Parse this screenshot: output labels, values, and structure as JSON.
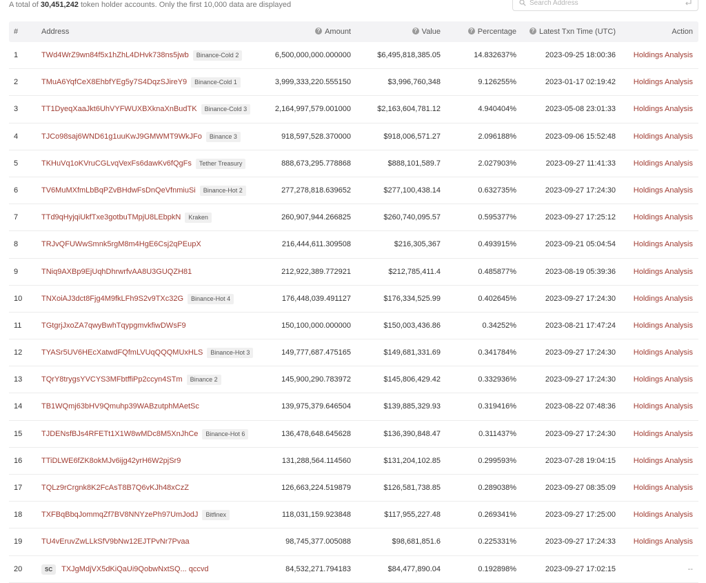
{
  "summary": {
    "prefix": "A total of",
    "count": "30,451,242",
    "suffix": "token holder accounts. Only the first 10,000 data are displayed"
  },
  "search": {
    "placeholder": "Search Address"
  },
  "table": {
    "headers": {
      "index": "#",
      "address": "Address",
      "amount": "Amount",
      "value": "Value",
      "percentage": "Percentage",
      "time": "Latest Txn Time (UTC)",
      "action": "Action"
    },
    "rows": [
      {
        "idx": "1",
        "sc": "",
        "address": "TWd4WrZ9wn84f5x1hZhL4DHvk738ns5jwb",
        "tag": "Binance-Cold 2",
        "amount": "6,500,000,000.000000",
        "value": "$6,495,818,385.05",
        "pct": "14.832637%",
        "time": "2023-09-25 18:00:36",
        "action": "Holdings Analysis"
      },
      {
        "idx": "2",
        "sc": "",
        "address": "TMuA6YqfCeX8EhbfYEg5y7S4DqzSJireY9",
        "tag": "Binance-Cold 1",
        "amount": "3,999,333,220.555150",
        "value": "$3,996,760,348",
        "pct": "9.126255%",
        "time": "2023-01-17 02:19:42",
        "action": "Holdings Analysis"
      },
      {
        "idx": "3",
        "sc": "",
        "address": "TT1DyeqXaaJkt6UhVYFWUXBXknaXnBudTK",
        "tag": "Binance-Cold 3",
        "amount": "2,164,997,579.001000",
        "value": "$2,163,604,781.12",
        "pct": "4.940404%",
        "time": "2023-05-08 23:01:33",
        "action": "Holdings Analysis"
      },
      {
        "idx": "4",
        "sc": "",
        "address": "TJCo98saj6WND61g1uuKwJ9GMWMT9WkJFo",
        "tag": "Binance 3",
        "amount": "918,597,528.370000",
        "value": "$918,006,571.27",
        "pct": "2.096188%",
        "time": "2023-09-06 15:52:48",
        "action": "Holdings Analysis"
      },
      {
        "idx": "5",
        "sc": "",
        "address": "TKHuVq1oKVruCGLvqVexFs6dawKv6fQgFs",
        "tag": "Tether Treasury",
        "amount": "888,673,295.778868",
        "value": "$888,101,589.7",
        "pct": "2.027903%",
        "time": "2023-09-27 11:41:33",
        "action": "Holdings Analysis"
      },
      {
        "idx": "6",
        "sc": "",
        "address": "TV6MuMXfmLbBqPZvBHdwFsDnQeVfnmiuSi",
        "tag": "Binance-Hot 2",
        "amount": "277,278,818.639652",
        "value": "$277,100,438.14",
        "pct": "0.632735%",
        "time": "2023-09-27 17:24:30",
        "action": "Holdings Analysis"
      },
      {
        "idx": "7",
        "sc": "",
        "address": "TTd9qHyjqiUkfTxe3gotbuTMpjU8LEbpkN",
        "tag": "Kraken",
        "amount": "260,907,944.266825",
        "value": "$260,740,095.57",
        "pct": "0.595377%",
        "time": "2023-09-27 17:25:12",
        "action": "Holdings Analysis"
      },
      {
        "idx": "8",
        "sc": "",
        "address": "TRJvQFUWwSmnk5rgM8m4HgE6Csj2qPEupX",
        "tag": "",
        "amount": "216,444,611.309508",
        "value": "$216,305,367",
        "pct": "0.493915%",
        "time": "2023-09-21 05:04:54",
        "action": "Holdings Analysis"
      },
      {
        "idx": "9",
        "sc": "",
        "address": "TNiq9AXBp9EjUqhDhrwrfvAA8U3GUQZH81",
        "tag": "",
        "amount": "212,922,389.772921",
        "value": "$212,785,411.4",
        "pct": "0.485877%",
        "time": "2023-08-19 05:39:36",
        "action": "Holdings Analysis"
      },
      {
        "idx": "10",
        "sc": "",
        "address": "TNXoiAJ3dct8Fjg4M9fkLFh9S2v9TXc32G",
        "tag": "Binance-Hot 4",
        "amount": "176,448,039.491127",
        "value": "$176,334,525.99",
        "pct": "0.402645%",
        "time": "2023-09-27 17:24:30",
        "action": "Holdings Analysis"
      },
      {
        "idx": "11",
        "sc": "",
        "address": "TGtgrjJxoZA7qwyBwhTqypgmvkfiwDWsF9",
        "tag": "",
        "amount": "150,100,000.000000",
        "value": "$150,003,436.86",
        "pct": "0.34252%",
        "time": "2023-08-21 17:47:24",
        "action": "Holdings Analysis"
      },
      {
        "idx": "12",
        "sc": "",
        "address": "TYASr5UV6HEcXatwdFQfmLVUqQQQMUxHLS",
        "tag": "Binance-Hot 3",
        "amount": "149,777,687.475165",
        "value": "$149,681,331.69",
        "pct": "0.341784%",
        "time": "2023-09-27 17:24:30",
        "action": "Holdings Analysis"
      },
      {
        "idx": "13",
        "sc": "",
        "address": "TQrY8trygsYVCYS3MFbtffiPp2ccyn4STm",
        "tag": "Binance 2",
        "amount": "145,900,290.783972",
        "value": "$145,806,429.42",
        "pct": "0.332936%",
        "time": "2023-09-27 17:24:30",
        "action": "Holdings Analysis"
      },
      {
        "idx": "14",
        "sc": "",
        "address": "TB1WQmj63bHV9Qmuhp39WABzutphMAetSc",
        "tag": "",
        "amount": "139,975,379.646504",
        "value": "$139,885,329.93",
        "pct": "0.319416%",
        "time": "2023-08-22 07:48:36",
        "action": "Holdings Analysis"
      },
      {
        "idx": "15",
        "sc": "",
        "address": "TJDENsfBJs4RFETt1X1W8wMDc8M5XnJhCe",
        "tag": "Binance-Hot 6",
        "amount": "136,478,648.645628",
        "value": "$136,390,848.47",
        "pct": "0.311437%",
        "time": "2023-09-27 17:24:30",
        "action": "Holdings Analysis"
      },
      {
        "idx": "16",
        "sc": "",
        "address": "TTiDLWE6fZK8okMJv6ijg42yrH6W2pjSr9",
        "tag": "",
        "amount": "131,288,564.114560",
        "value": "$131,204,102.85",
        "pct": "0.299593%",
        "time": "2023-07-28 19:04:15",
        "action": "Holdings Analysis"
      },
      {
        "idx": "17",
        "sc": "",
        "address": "TQLz9rCrgnk8K2FcAsT8B7Q6vKJh48xCzZ",
        "tag": "",
        "amount": "126,663,224.519879",
        "value": "$126,581,738.85",
        "pct": "0.289038%",
        "time": "2023-09-27 08:35:09",
        "action": "Holdings Analysis"
      },
      {
        "idx": "18",
        "sc": "",
        "address": "TXFBqBbqJommqZf7BV8NNYzePh97UmJodJ",
        "tag": "Bitfinex",
        "amount": "118,031,159.923848",
        "value": "$117,955,227.48",
        "pct": "0.269341%",
        "time": "2023-09-27 17:25:00",
        "action": "Holdings Analysis"
      },
      {
        "idx": "19",
        "sc": "",
        "address": "TU4vEruvZwLLkSfV9bNw12EJTPvNr7Pvaa",
        "tag": "",
        "amount": "98,745,377.005088",
        "value": "$98,681,851.6",
        "pct": "0.225331%",
        "time": "2023-09-27 17:24:33",
        "action": "Holdings Analysis"
      },
      {
        "idx": "20",
        "sc": "SC",
        "address": "TXJgMdjVX5dKiQaUi9QobwNxtSQ... qccvd",
        "tag": "",
        "amount": "84,532,271.794183",
        "value": "$84,477,890.04",
        "pct": "0.192898%",
        "time": "2023-09-27 17:02:15",
        "action": "--"
      }
    ]
  }
}
